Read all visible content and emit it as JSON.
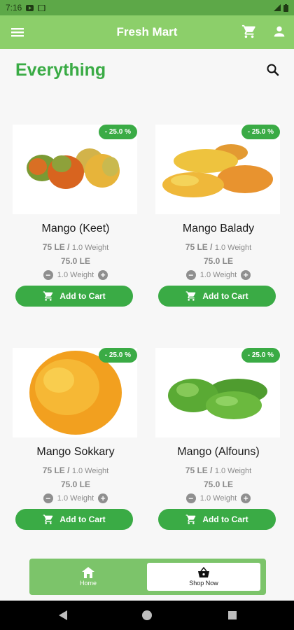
{
  "status_bar": {
    "time": "7:16"
  },
  "app_bar": {
    "title": "Fresh Mart"
  },
  "page": {
    "title": "Everything"
  },
  "colors": {
    "brand_green": "#3aab45",
    "appbar_green": "#8ccf6a",
    "nav_green": "#7cc46a"
  },
  "products": [
    {
      "name": "Mango (Keet)",
      "badge": "- 25.0 %",
      "price": "75 LE /",
      "weight_unit": "1.0 Weight",
      "total": "75.0 LE",
      "quantity": "1.0 Weight",
      "add_label": "Add  to Cart"
    },
    {
      "name": "Mango Balady",
      "badge": "- 25.0 %",
      "price": "75 LE /",
      "weight_unit": "1.0 Weight",
      "total": "75.0 LE",
      "quantity": "1.0 Weight",
      "add_label": "Add  to Cart"
    },
    {
      "name": "Mango Sokkary",
      "badge": "- 25.0 %",
      "price": "75 LE /",
      "weight_unit": "1.0 Weight",
      "total": "75.0 LE",
      "quantity": "1.0 Weight",
      "add_label": "Add  to Cart"
    },
    {
      "name": "Mango (Alfouns)",
      "badge": "- 25.0 %",
      "price": "75 LE /",
      "weight_unit": "1.0 Weight",
      "total": "75.0 LE",
      "quantity": "1.0 Weight",
      "add_label": "Add  to Cart"
    }
  ],
  "bottom_nav": {
    "home": "Home",
    "shop": "Shop Now"
  },
  "icons": [
    "menu-icon",
    "cart-icon",
    "user-icon",
    "search-icon",
    "minus-icon",
    "plus-icon",
    "home-icon",
    "basket-icon",
    "back-icon",
    "home-circle-icon",
    "recents-icon"
  ]
}
